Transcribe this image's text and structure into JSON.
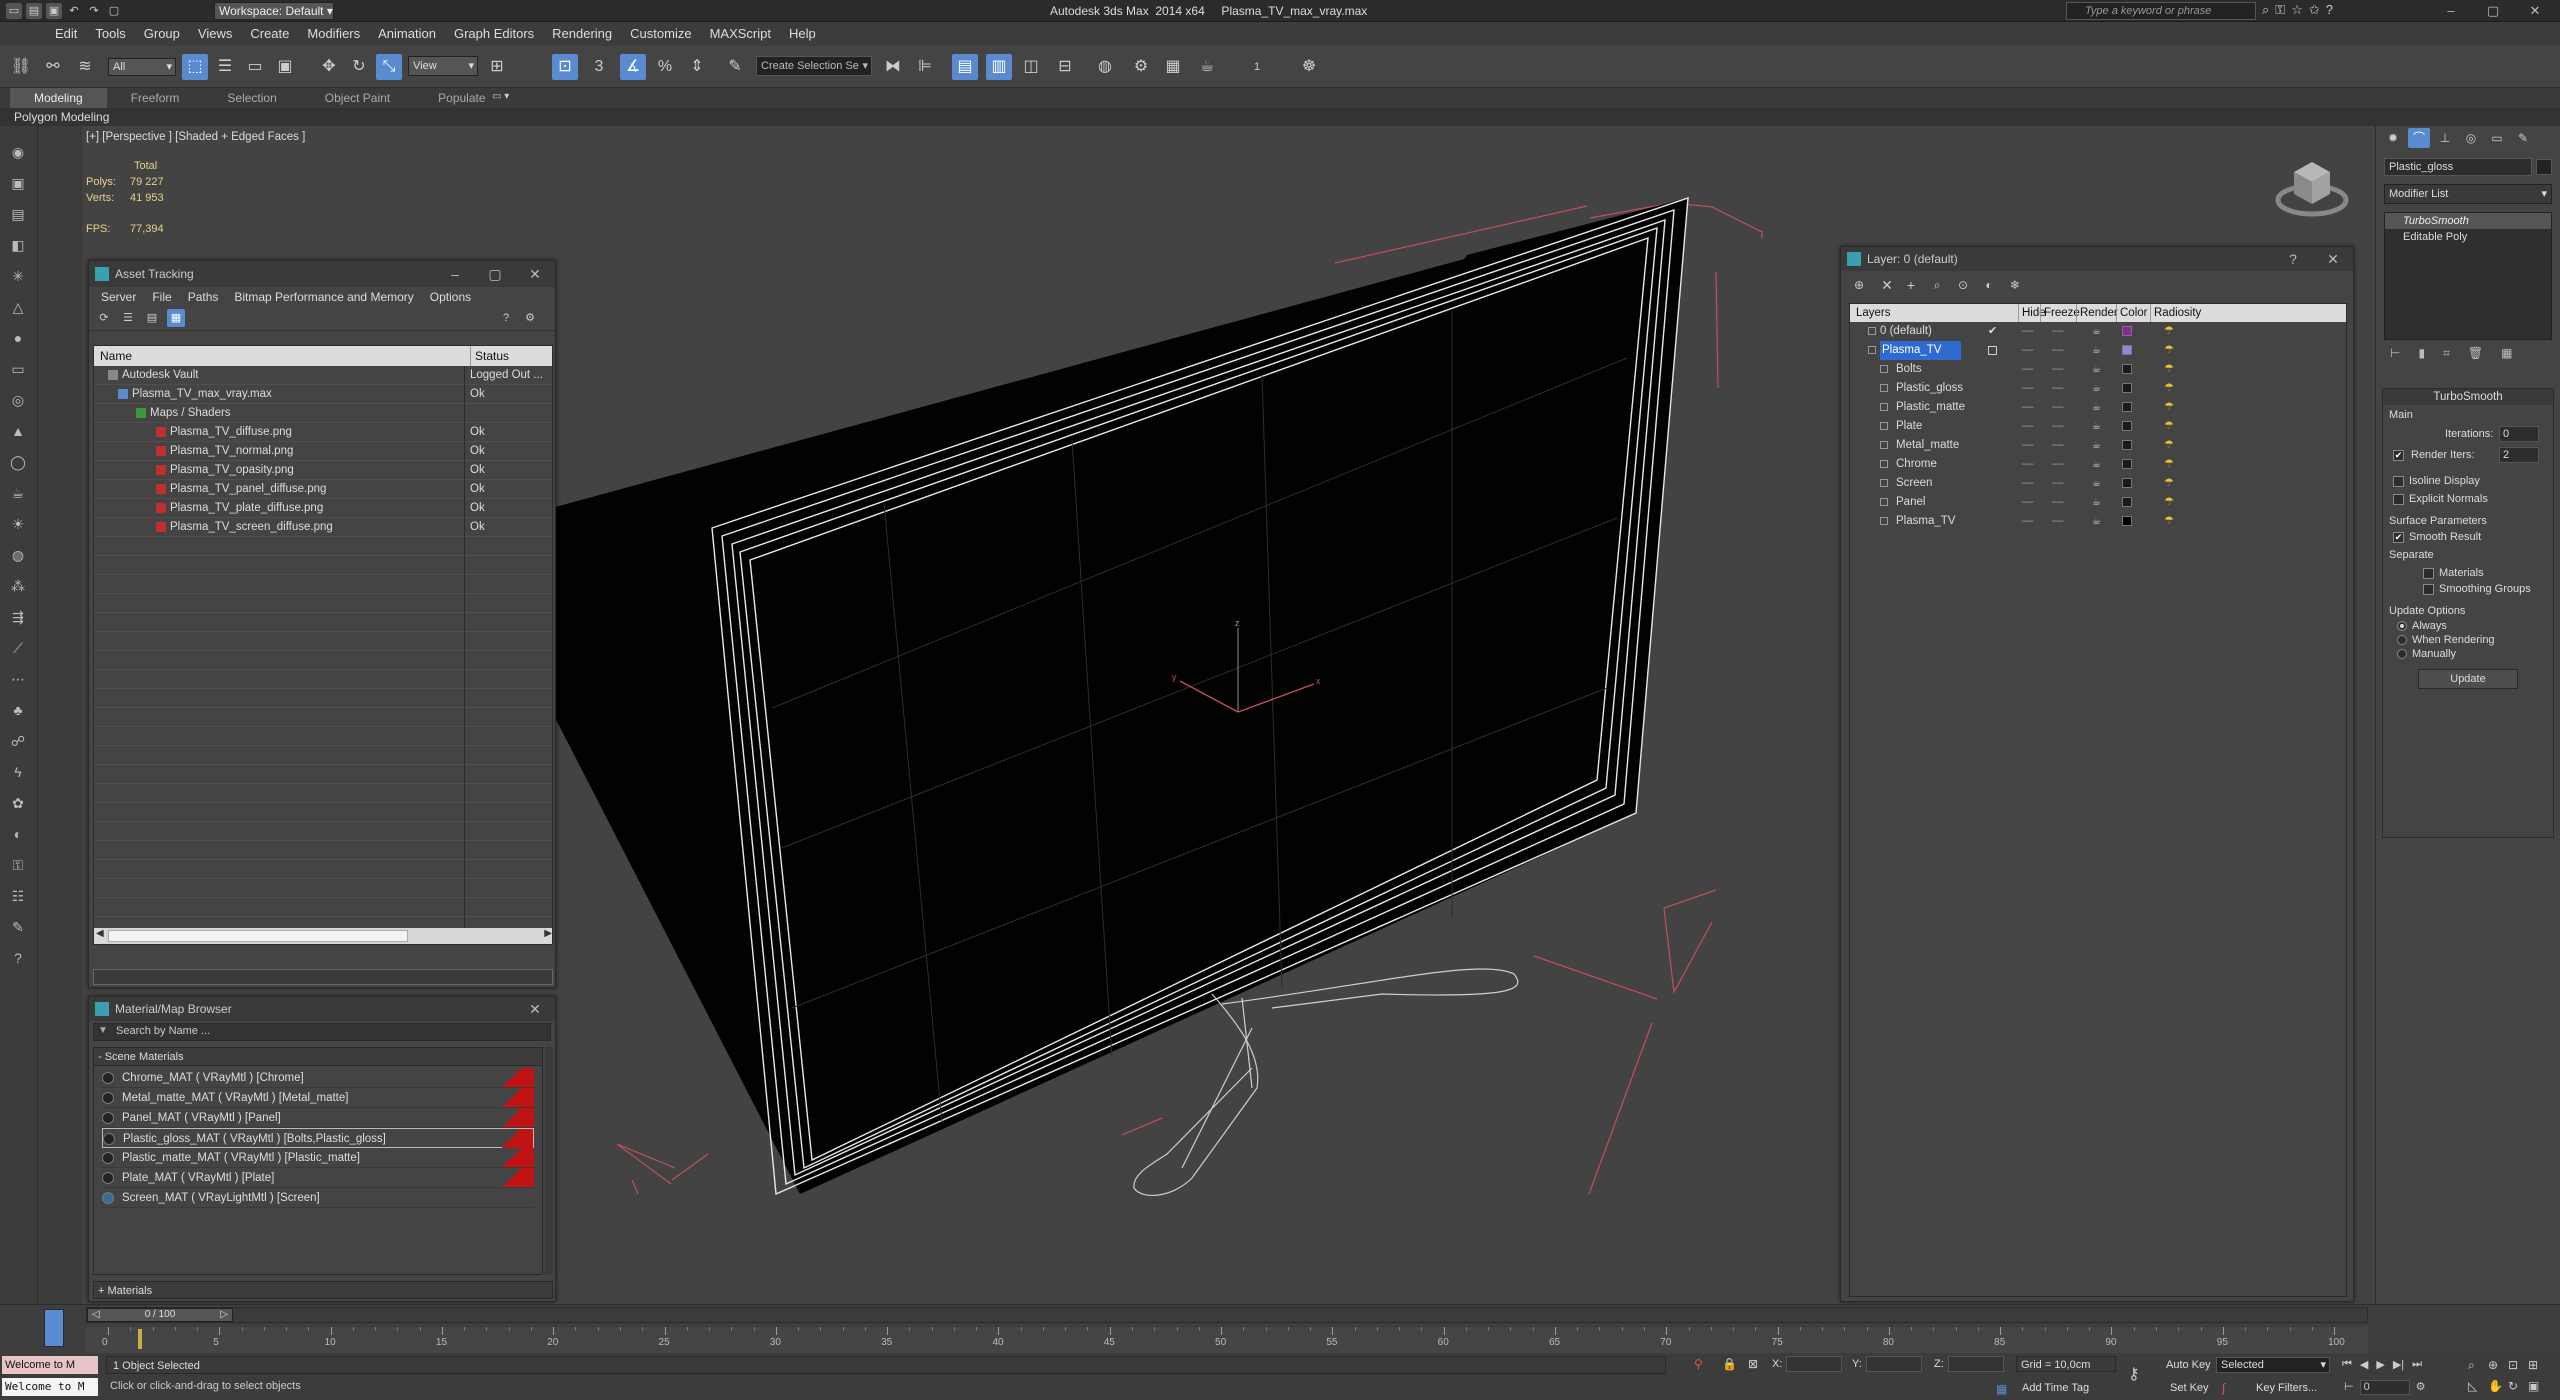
{
  "app": {
    "title": "Autodesk 3ds Max  2014 x64     Plasma_TV_max_vray.max",
    "workspace": "Workspace: Default",
    "search_placeholder": "Type a keyword or phrase"
  },
  "menu": [
    "Edit",
    "Tools",
    "Group",
    "Views",
    "Create",
    "Modifiers",
    "Animation",
    "Graph Editors",
    "Rendering",
    "Customize",
    "MAXScript",
    "Help"
  ],
  "toolbar": {
    "selection_filter": "All",
    "ref_coord": "View",
    "named_selection": "Create Selection Se",
    "spinner_value": "1"
  },
  "ribbon": {
    "tabs": [
      "Modeling",
      "Freeform",
      "Selection",
      "Object Paint",
      "Populate"
    ],
    "active_tab": "Modeling",
    "sub_label": "Polygon Modeling"
  },
  "viewport": {
    "label": "[+] [Perspective ] [Shaded + Edged Faces ]",
    "stats": {
      "total_label": "Total",
      "polys_label": "Polys:",
      "polys_value": "79 227",
      "verts_label": "Verts:",
      "verts_value": "41 953",
      "fps_label": "FPS:",
      "fps_value": "77,394"
    },
    "axis_labels": {
      "x": "x",
      "y": "y",
      "z": "z"
    }
  },
  "asset_tracking": {
    "title": "Asset Tracking",
    "menu": [
      "Server",
      "File",
      "Paths",
      "Bitmap Performance and Memory",
      "Options"
    ],
    "col_name": "Name",
    "col_status": "Status",
    "rows": [
      {
        "name": "Autodesk Vault",
        "status": "Logged Out ..."
      },
      {
        "name": "Plasma_TV_max_vray.max",
        "status": "Ok"
      },
      {
        "name": "Maps / Shaders",
        "status": ""
      },
      {
        "name": "Plasma_TV_diffuse.png",
        "status": "Ok"
      },
      {
        "name": "Plasma_TV_normal.png",
        "status": "Ok"
      },
      {
        "name": "Plasma_TV_opasity.png",
        "status": "Ok"
      },
      {
        "name": "Plasma_TV_panel_diffuse.png",
        "status": "Ok"
      },
      {
        "name": "Plasma_TV_plate_diffuse.png",
        "status": "Ok"
      },
      {
        "name": "Plasma_TV_screen_diffuse.png",
        "status": "Ok"
      }
    ]
  },
  "material_browser": {
    "title": "Material/Map Browser",
    "search_placeholder": "Search by Name ...",
    "section_scene": "- Scene Materials",
    "section_materials": "+ Materials",
    "items": [
      "Chrome_MAT  ( VRayMtl ) [Chrome]",
      "Metal_matte_MAT  ( VRayMtl ) [Metal_matte]",
      "Panel_MAT  ( VRayMtl ) [Panel]",
      "Plastic_gloss_MAT  ( VRayMtl ) [Bolts,Plastic_gloss]",
      "Plastic_matte_MAT  ( VRayMtl ) [Plastic_matte]",
      "Plate_MAT  ( VRayMtl ) [Plate]",
      "Screen_MAT  ( VRayLightMtl ) [Screen]"
    ]
  },
  "layer_manager": {
    "title": "Layer: 0 (default)",
    "columns": [
      "Layers",
      "Hide",
      "Freeze",
      "Render",
      "Color",
      "Radiosity"
    ],
    "layers": [
      {
        "name": "0 (default)",
        "color": "#8a2a9a"
      },
      {
        "name": "Plasma_TV",
        "color": "#9a80e0"
      },
      {
        "name": "Bolts",
        "color": "#1a1a1a"
      },
      {
        "name": "Plastic_gloss",
        "color": "#1a1a1a"
      },
      {
        "name": "Plastic_matte",
        "color": "#1a1a1a"
      },
      {
        "name": "Plate",
        "color": "#1a1a1a"
      },
      {
        "name": "Metal_matte",
        "color": "#1a1a1a"
      },
      {
        "name": "Chrome",
        "color": "#1a1a1a"
      },
      {
        "name": "Screen",
        "color": "#1a1a1a"
      },
      {
        "name": "Panel",
        "color": "#1a1a1a"
      },
      {
        "name": "Plasma_TV",
        "color": "#000000"
      }
    ]
  },
  "command_panel": {
    "object_name": "Plastic_gloss",
    "modifier_list": "Modifier List",
    "stack": [
      "TurboSmooth",
      "Editable Poly"
    ],
    "rollout_title": "TurboSmooth",
    "main_label": "Main",
    "iterations_label": "Iterations:",
    "iterations_value": "0",
    "render_iters_label": "Render Iters:",
    "render_iters_value": "2",
    "isoline_label": "Isoline Display",
    "explicit_normals_label": "Explicit Normals",
    "surface_params_label": "Surface Parameters",
    "smooth_result_label": "Smooth Result",
    "separate_label": "Separate",
    "materials_label": "Materials",
    "smoothing_groups_label": "Smoothing Groups",
    "update_options_label": "Update Options",
    "always_label": "Always",
    "when_rendering_label": "When Rendering",
    "manually_label": "Manually",
    "update_button": "Update"
  },
  "timeline": {
    "frame_label": "0 / 100",
    "ticks": [
      "0",
      "5",
      "10",
      "15",
      "20",
      "25",
      "30",
      "35",
      "40",
      "45",
      "50",
      "55",
      "60",
      "65",
      "70",
      "75",
      "80",
      "85",
      "90",
      "95",
      "100"
    ]
  },
  "status": {
    "script_prompt": "Welcome to M",
    "selection": "1 Object Selected",
    "hint": "Click or click-and-drag to select objects",
    "x_label": "X:",
    "y_label": "Y:",
    "z_label": "Z:",
    "grid": "Grid = 10,0cm",
    "add_time_tag": "Add Time Tag",
    "auto_key": "Auto Key",
    "selected": "Selected",
    "set_key": "Set Key",
    "key_filters": "Key Filters...",
    "frame_value": "0"
  },
  "colors": {
    "accent": "#5a8bd0",
    "stats_text": "#e7d28a",
    "bbox": "#c0505a",
    "mat_flag": "#c01414"
  }
}
